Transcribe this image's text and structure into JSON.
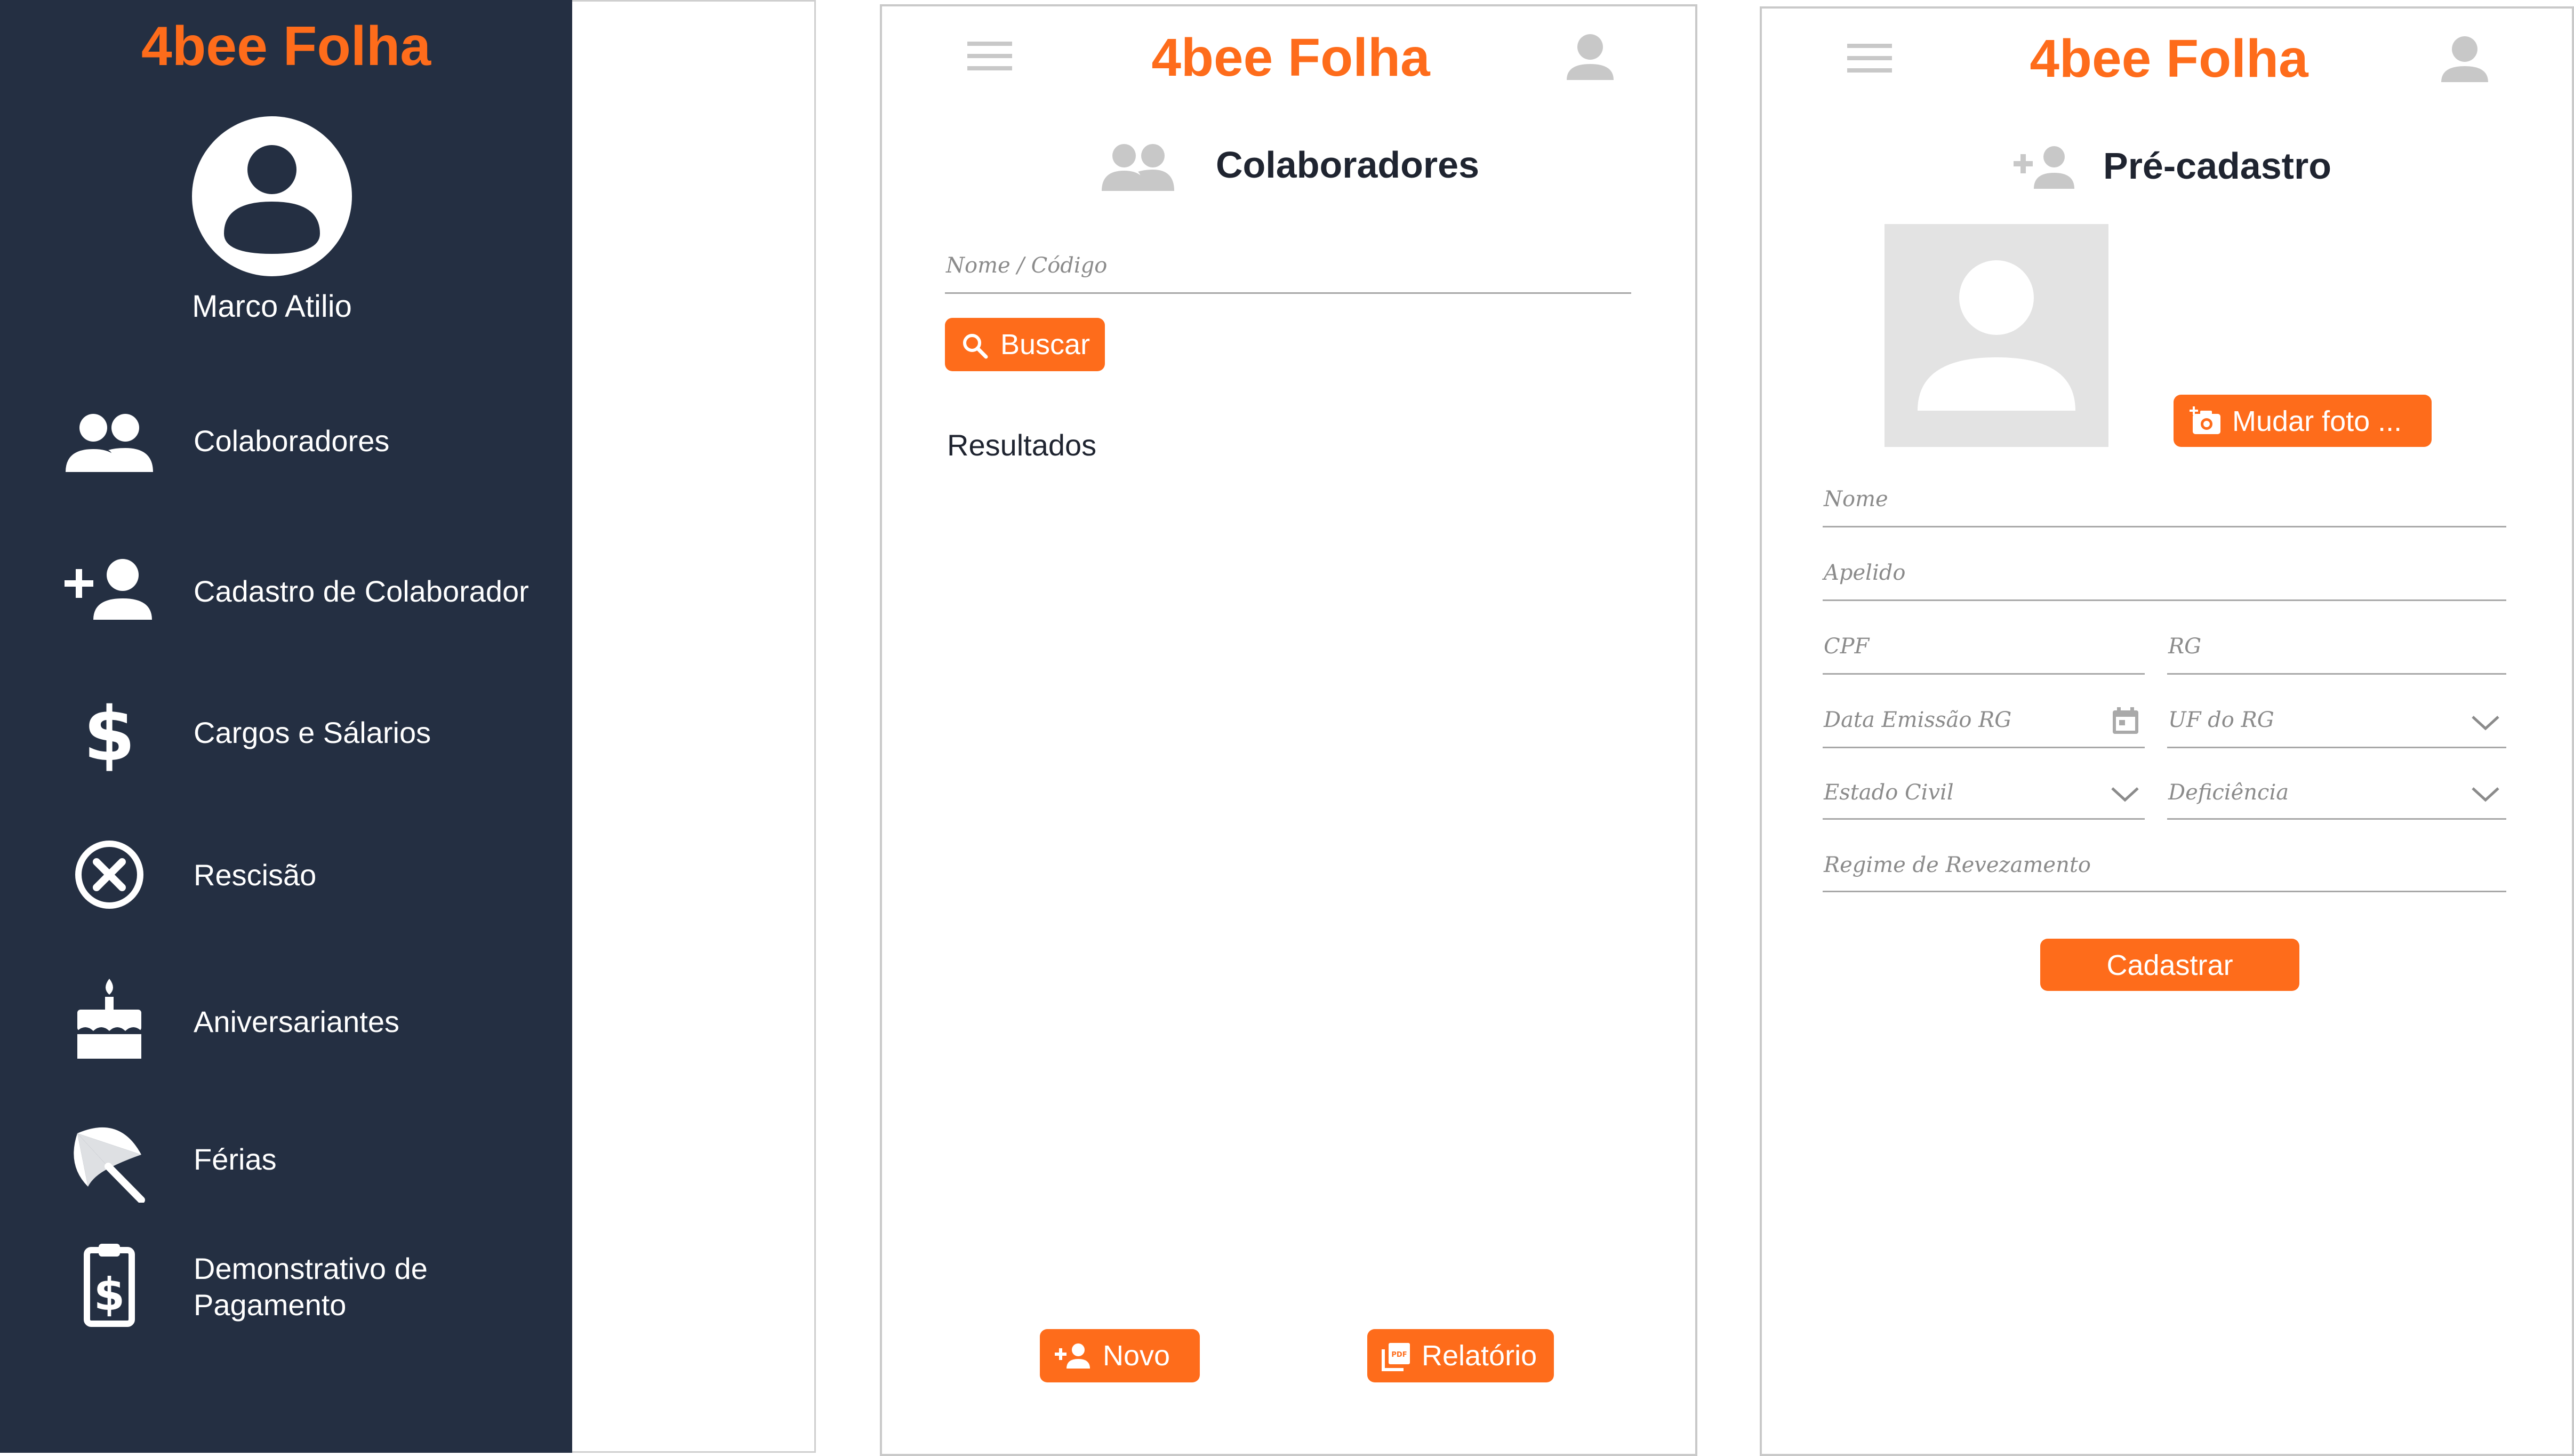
{
  "drawer": {
    "logo": "4bee Folha",
    "user_name": "Marco Atilio",
    "items": [
      {
        "label": "Colaboradores",
        "icon": "group-icon"
      },
      {
        "label": "Cadastro de Colaborador",
        "icon": "person-add-icon"
      },
      {
        "label": "Cargos e Sálarios",
        "icon": "dollar-icon"
      },
      {
        "label": "Rescisão",
        "icon": "cancel-icon"
      },
      {
        "label": "Aniversariantes",
        "icon": "cake-icon"
      },
      {
        "label": "Férias",
        "icon": "beach-umbrella-icon"
      },
      {
        "label": "Demonstrativo de",
        "label2": "Pagamento",
        "icon": "payment-clipboard-icon"
      }
    ]
  },
  "screen_colaboradores": {
    "logo": "4bee Folha",
    "title": "Colaboradores",
    "search_placeholder": "Nome / Código",
    "search_button": "Buscar",
    "results_label": "Resultados",
    "new_button": "Novo",
    "report_button": "Relatório"
  },
  "screen_precadastro": {
    "logo": "4bee Folha",
    "title": "Pré-cadastro",
    "change_photo_button": "Mudar foto ...",
    "fields": {
      "nome": "Nome",
      "apelido": "Apelido",
      "cpf": "CPF",
      "rg": "RG",
      "data_emissao_rg": "Data Emissão RG",
      "uf_rg": "UF do RG",
      "estado_civil": "Estado Civil",
      "deficiencia": "Deficiência",
      "regime": "Regime de Revezamento"
    },
    "submit_button": "Cadastrar"
  },
  "colors": {
    "accent": "#FE6C1B",
    "drawer_bg": "#242F42",
    "icon_gray": "#c8c8c8"
  }
}
